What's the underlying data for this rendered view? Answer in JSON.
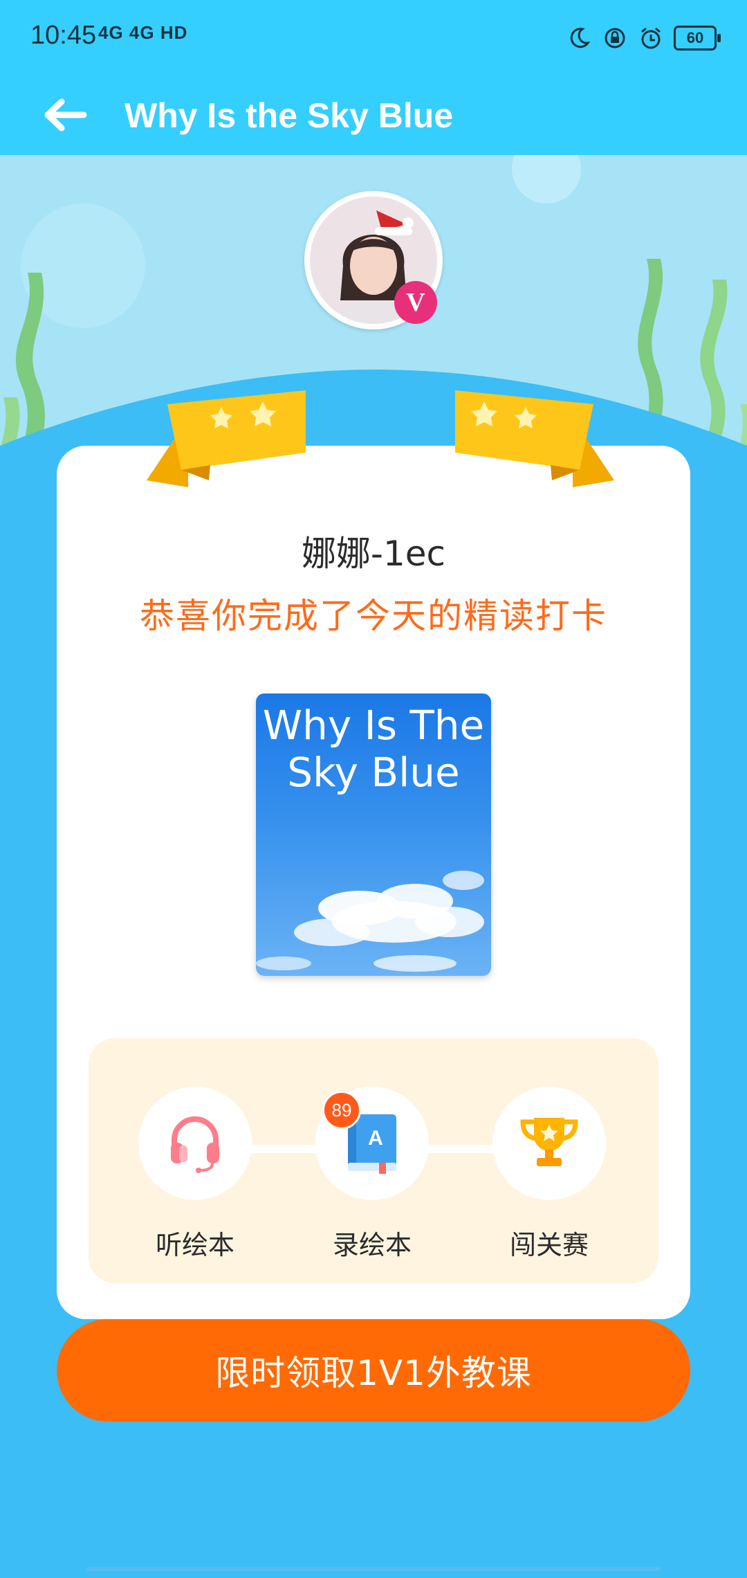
{
  "status_bar": {
    "time": "10:45",
    "signal_text": "4G 4G HD",
    "battery": "60"
  },
  "header": {
    "title": "Why Is the Sky Blue"
  },
  "profile": {
    "username": "娜娜-1ec",
    "vip_badge": "V"
  },
  "message": {
    "congrats": "恭喜你完成了今天的精读打卡"
  },
  "book": {
    "cover_title": "Why Is The Sky Blue"
  },
  "activities": [
    {
      "label": "听绘本",
      "icon": "headphones-icon"
    },
    {
      "label": "录绘本",
      "icon": "book-icon",
      "badge": "89"
    },
    {
      "label": "闯关赛",
      "icon": "trophy-icon"
    }
  ],
  "cta": {
    "label": "限时领取1V1外教课"
  },
  "colors": {
    "header_bg": "#34CFFF",
    "page_bg": "#3CBDF5",
    "accent_orange": "#FF6A05",
    "congrats_text": "#FF6A1A",
    "ribbon": "#FFC61A",
    "activity_panel": "#FFF4E0",
    "vip_pink": "#E8307A"
  }
}
